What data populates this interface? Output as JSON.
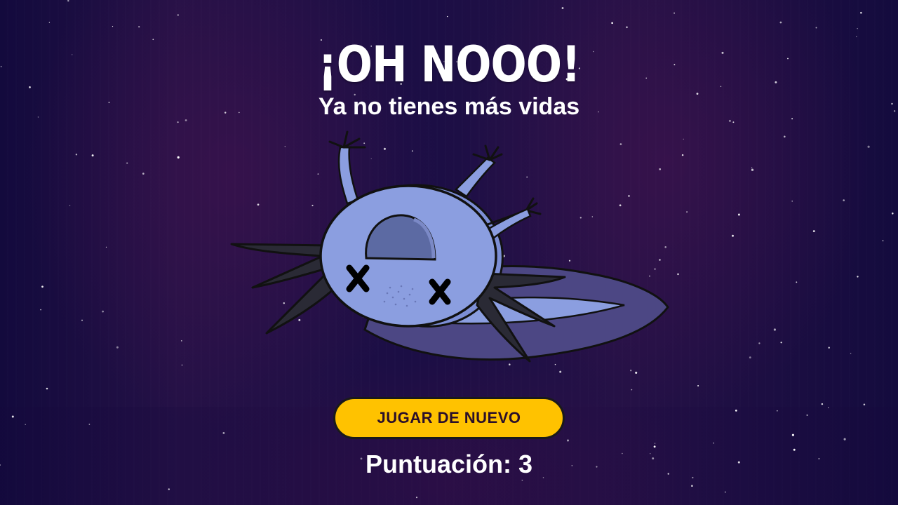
{
  "screen": {
    "title": "¡OH NOOO!",
    "subtitle": "Ya no tienes más vidas",
    "play_again_label": "JUGAR DE NUEVO",
    "score_text": "Puntuación: 3"
  },
  "character": {
    "icon": "dead-axolotl-icon",
    "state": "dead"
  },
  "colors": {
    "background": "#1b0e45",
    "button": "#ffc200",
    "button_text": "#2a0f2a",
    "text": "#ffffff",
    "axolotl_body": "#8b9ee0",
    "axolotl_gills": "#2a2a35"
  }
}
